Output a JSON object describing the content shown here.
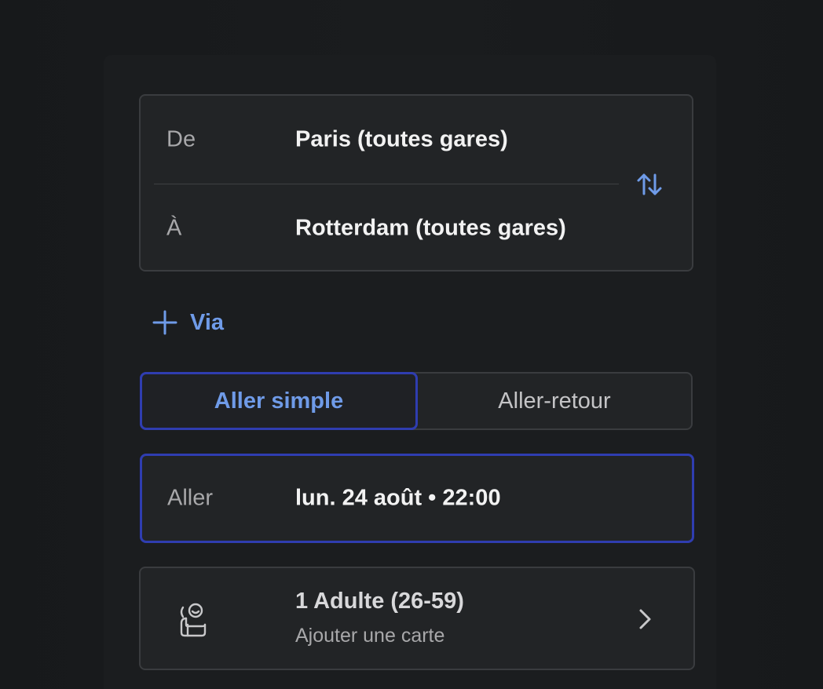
{
  "route": {
    "from_label": "De",
    "from_value": "Paris (toutes gares)",
    "to_label": "À",
    "to_value": "Rotterdam (toutes gares)",
    "swap_icon": "swap-vertical-icon"
  },
  "via": {
    "icon": "plus-icon",
    "label": "Via"
  },
  "trip_type": {
    "options": [
      "Aller simple",
      "Aller-retour"
    ],
    "selected": "Aller simple"
  },
  "outbound": {
    "label": "Aller",
    "value": "lun. 24 août • 22:00"
  },
  "passengers": {
    "icon": "passenger-icon",
    "title": "1 Adulte (26-59)",
    "subtitle": "Ajouter une carte",
    "chevron_icon": "chevron-right-icon"
  },
  "colors": {
    "accent": "#6f9be8",
    "focus_border": "#2f3db0",
    "background": "#17191b",
    "card": "#222426"
  }
}
